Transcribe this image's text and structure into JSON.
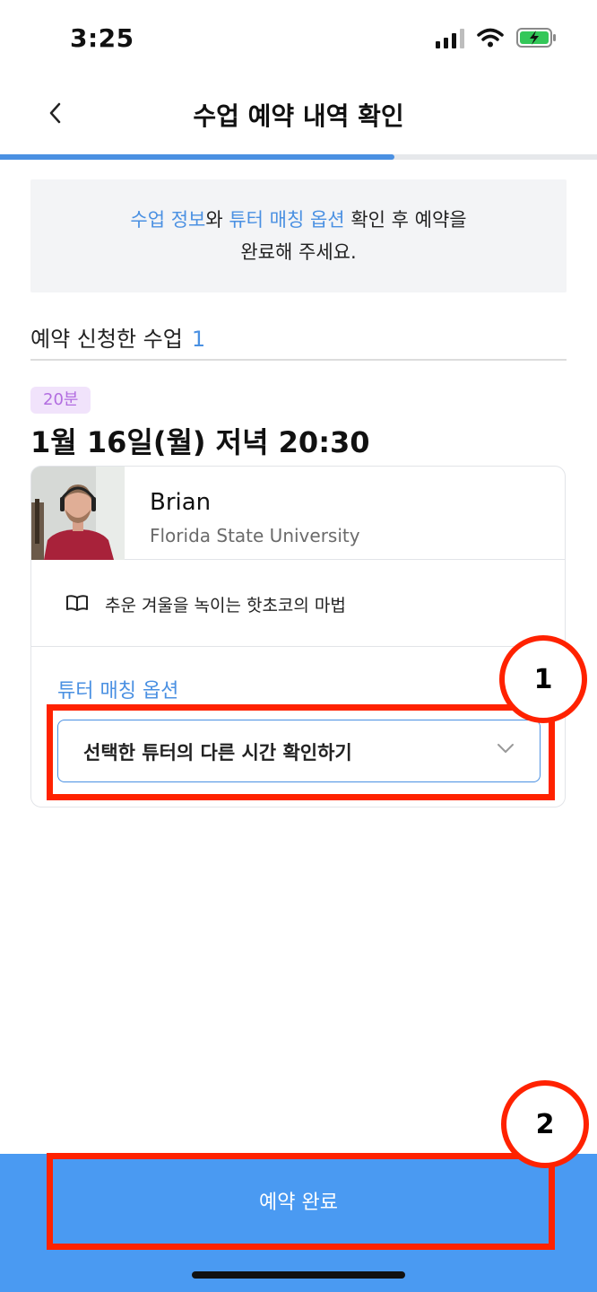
{
  "status_bar": {
    "time": "3:25"
  },
  "header": {
    "title": "수업 예약 내역 확인"
  },
  "progress": {
    "fraction": 0.66
  },
  "info_box": {
    "line1_link1": "수업 정보",
    "line1_text1": "와 ",
    "line1_link2": "튜터 매칭 옵션",
    "line1_text2": " 확인 후 예약을",
    "line2": "완료해 주세요."
  },
  "section": {
    "title": "예약 신청한 수업",
    "count": "1"
  },
  "lesson": {
    "duration": "20분",
    "datetime": "1월 16일(월) 저녁 20:30",
    "tutor_name": "Brian",
    "tutor_university": "Florida State University",
    "topic": "추운 겨울을 녹이는 핫초코의 마법"
  },
  "matching": {
    "label": "튜터 매칭 옵션",
    "selected": "선택한 튜터의 다른 시간 확인하기"
  },
  "annotations": {
    "marker1": "1",
    "marker2": "2"
  },
  "submit": {
    "label": "예약 완료"
  },
  "colors": {
    "accent": "#4a90e2",
    "button": "#4a9af2",
    "annotation": "#ff2200",
    "badge_bg": "#f1e3fb",
    "badge_text": "#b26de0"
  }
}
